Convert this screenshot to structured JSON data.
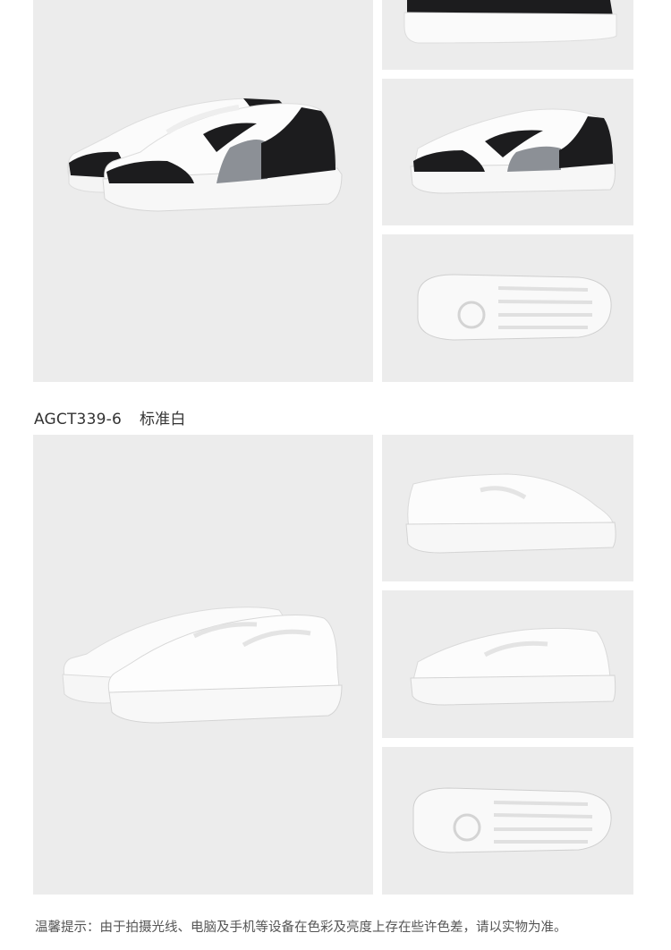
{
  "variant": {
    "code": "AGCT339-6",
    "color_name": "标准白"
  },
  "notice": "温馨提示：由于拍摄光线、电脑及手机等设备在色彩及亮度上存在些许色差，请以实物为准。",
  "images": [
    {
      "id": "black-pair",
      "subject": "sneaker-pair-black-white"
    },
    {
      "id": "black-top",
      "subject": "sneaker-heel-black-white"
    },
    {
      "id": "black-side",
      "subject": "sneaker-side-black-white"
    },
    {
      "id": "black-sole",
      "subject": "sneaker-outsole-white"
    },
    {
      "id": "white-pair",
      "subject": "sneaker-pair-white"
    },
    {
      "id": "white-side1",
      "subject": "sneaker-side-white"
    },
    {
      "id": "white-side2",
      "subject": "sneaker-side-white"
    },
    {
      "id": "white-sole",
      "subject": "sneaker-outsole-white"
    }
  ],
  "colors": {
    "panel_bg": "#ececec",
    "shoe_black": "#1c1c1e",
    "shoe_grey": "#8c9096",
    "shoe_white": "#fafafa"
  }
}
